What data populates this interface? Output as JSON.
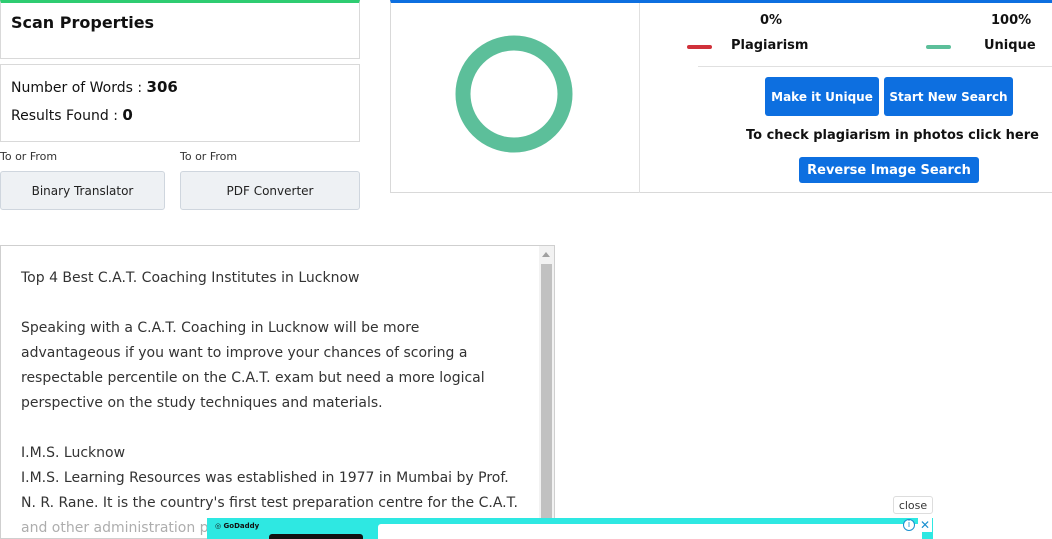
{
  "scan": {
    "title": "Scan Properties",
    "words_label": "Number of Words :",
    "words_value": "306",
    "results_label": "Results Found :",
    "results_value": "0"
  },
  "tools": [
    {
      "caption": "To or From",
      "button": "Binary Translator"
    },
    {
      "caption": "To or From",
      "button": "PDF Converter"
    }
  ],
  "results": {
    "plagiarism_percent": "0%",
    "unique_percent": "100%",
    "plagiarism_label": "Plagiarism",
    "unique_label": "Unique",
    "plagiarism_color": "#d0313a",
    "unique_color": "#5cbf9a",
    "donut_unique_fraction": 1.0,
    "make_unique_label": "Make it Unique",
    "new_search_label": "Start New Search",
    "photo_prompt": "To check plagiarism in photos click here",
    "reverse_image_label": "Reverse Image Search"
  },
  "content": {
    "heading": "Top 4 Best C.A.T. Coaching Institutes in Lucknow",
    "para1": "Speaking with a C.A.T. Coaching in Lucknow will be more advantageous if you want to improve your chances of scoring a respectable percentile on the C.A.T. exam but need a more logical perspective on the study techniques and materials.",
    "subheading": "I.M.S. Lucknow",
    "para2": "I.M.S. Learning Resources was established in 1977 in Mumbai by Prof. N. R. Rane. It is the country's first test preparation centre for the C.A.T. and other administration places"
  },
  "ad": {
    "close_label": "close",
    "brand": "GoDaddy",
    "info_icon": "info-icon",
    "close_icon": "close-icon"
  }
}
